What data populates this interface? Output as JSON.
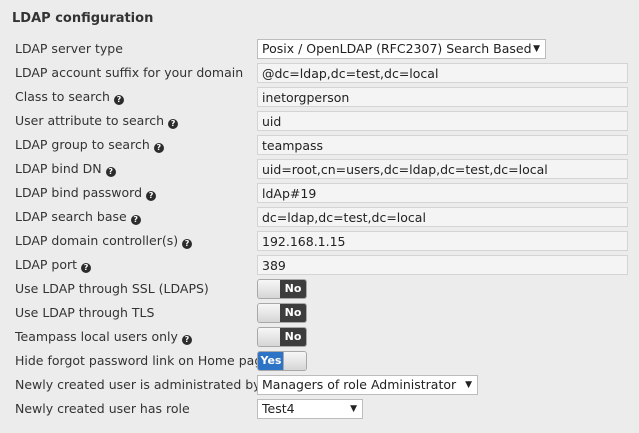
{
  "section": {
    "title": "LDAP configuration"
  },
  "rows": {
    "server_type": {
      "label": "LDAP server type",
      "value": "Posix / OpenLDAP (RFC2307) Search Based"
    },
    "account_suffix": {
      "label": "LDAP account suffix for your domain",
      "value": "@dc=ldap,dc=test,dc=local"
    },
    "class_to_search": {
      "label": "Class to search",
      "value": "inetorgperson"
    },
    "user_attribute": {
      "label": "User attribute to search",
      "value": "uid"
    },
    "group_to_search": {
      "label": "LDAP group to search",
      "value": "teampass"
    },
    "bind_dn": {
      "label": "LDAP bind DN",
      "value": "uid=root,cn=users,dc=ldap,dc=test,dc=local"
    },
    "bind_password": {
      "label": "LDAP bind password",
      "value": "ldAp#19"
    },
    "search_base": {
      "label": "LDAP search base",
      "value": "dc=ldap,dc=test,dc=local"
    },
    "domain_controllers": {
      "label": "LDAP domain controller(s)",
      "value": "192.168.1.15"
    },
    "port": {
      "label": "LDAP port",
      "value": "389"
    },
    "use_ssl": {
      "label": "Use LDAP through SSL (LDAPS)",
      "state": "No"
    },
    "use_tls": {
      "label": "Use LDAP through TLS",
      "state": "No"
    },
    "local_users_only": {
      "label": "Teampass local users only",
      "state": "No"
    },
    "hide_forgot_link": {
      "label": "Hide forgot password link on Home page",
      "state": "Yes"
    },
    "administered_by": {
      "label": "Newly created user is administrated by",
      "value": "Managers of role Administrator"
    },
    "new_user_role": {
      "label": "Newly created user has role",
      "value": "Test4"
    }
  },
  "icons": {
    "help": "question-circle-icon",
    "dropdown": "caret-down-icon"
  },
  "icon_glyphs": {
    "help": "?",
    "dropdown": "▼"
  },
  "colors": {
    "background": "#ececec",
    "toggle_on": "#2d74c6",
    "toggle_off": "#3d3d3d",
    "help_icon": "#2c2c2c"
  }
}
